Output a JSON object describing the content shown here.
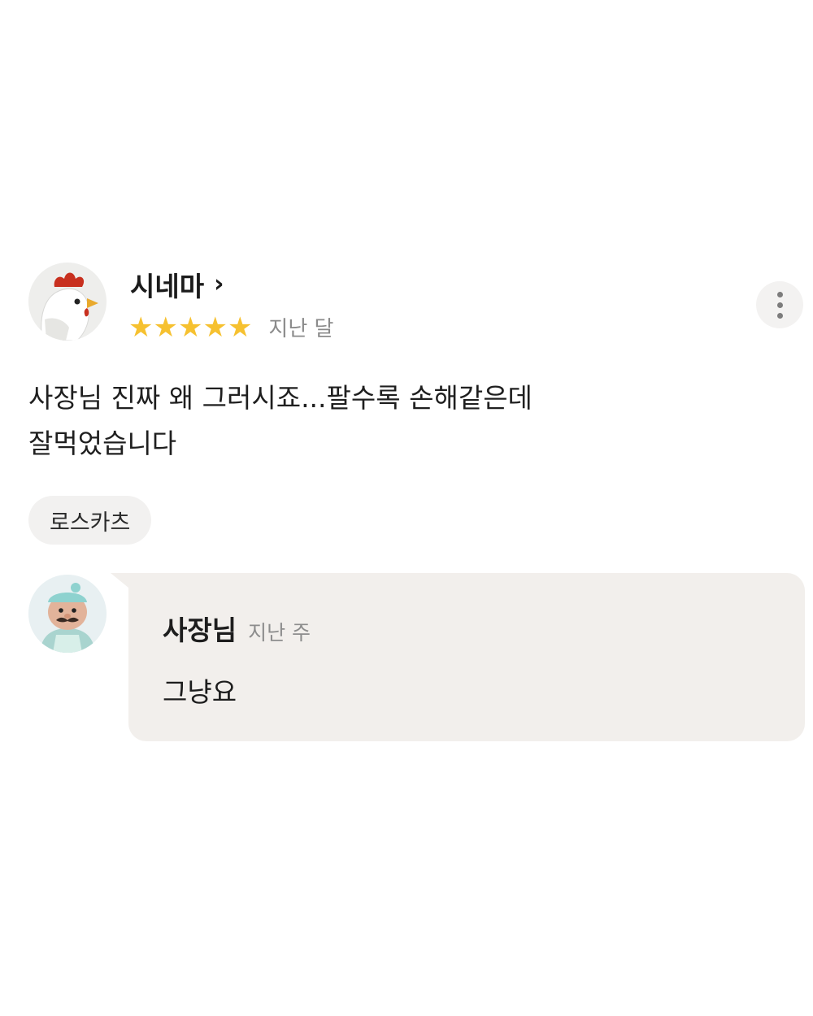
{
  "review": {
    "user": {
      "name": "시네마",
      "avatar_icon": "chicken-avatar-icon",
      "chevron": "›"
    },
    "rating": 5,
    "rating_max": 5,
    "star_glyph": "★",
    "star_color": "#f6c130",
    "date": "지난 달",
    "body_lines": [
      "사장님 진짜 왜 그러시죠...팔수록 손해같은데",
      "잘먹었습니다"
    ],
    "menu_tag": "로스카츠",
    "more_icon": "more-vertical-icon"
  },
  "owner_reply": {
    "name": "사장님",
    "avatar_icon": "owner-avatar-icon",
    "date": "지난 주",
    "text": "그냥요",
    "bubble_color": "#f2efec"
  }
}
